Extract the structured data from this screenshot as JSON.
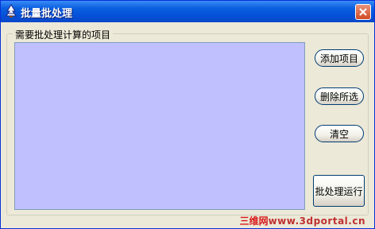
{
  "window": {
    "title": "批量批处理",
    "icon": "tree-app-icon",
    "close_icon": "close-icon"
  },
  "group": {
    "label": "需要批处理计算的项目"
  },
  "list": {
    "items": []
  },
  "buttons": {
    "add": "添加项目",
    "delete_selected": "删除所选",
    "clear": "清空",
    "run_batch": "批处理运行"
  },
  "watermark": {
    "brand": "三维网",
    "url": "www.3dportal.cn"
  },
  "colors": {
    "list_background": "#c0c0ff",
    "titlebar": "#0a5fe0",
    "watermark": "#d81a1a"
  }
}
